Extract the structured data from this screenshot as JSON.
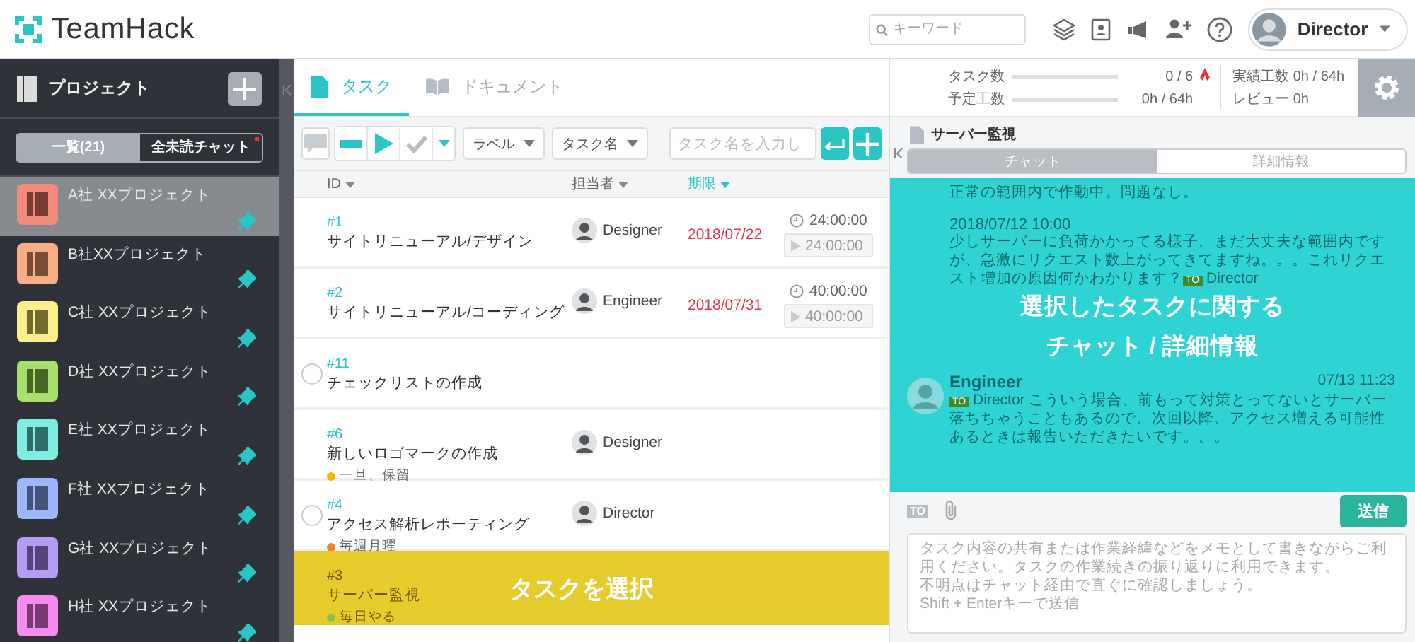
{
  "header": {
    "logo": "TeamHack",
    "search": {
      "placeholder": "キーワード"
    },
    "user": {
      "name": "Director"
    }
  },
  "sidebar": {
    "title": "プロジェクト",
    "tabs": [
      {
        "label": "一覧(21)",
        "selected": true,
        "unread": false
      },
      {
        "label": "全未読チャット",
        "selected": false,
        "unread": true
      }
    ],
    "projects": [
      {
        "name": "A社 XXプロジェクト",
        "color": "#f28b7a",
        "selected": true
      },
      {
        "name": "B社XXプロジェクト",
        "color": "#f7ae86",
        "selected": false
      },
      {
        "name": "C社 XXプロジェクト",
        "color": "#fbee8c",
        "selected": false
      },
      {
        "name": "D社 XXプロジェクト",
        "color": "#a8e06c",
        "selected": false
      },
      {
        "name": "E社 XXプロジェクト",
        "color": "#80ece2",
        "selected": false
      },
      {
        "name": "F社 XXプロジェクト",
        "color": "#9cb8fa",
        "selected": false
      },
      {
        "name": "G社 XXプロジェクト",
        "color": "#b69bf5",
        "selected": false
      },
      {
        "name": "H社 XXプロジェクト",
        "color": "#f68cf0",
        "selected": false
      }
    ]
  },
  "main": {
    "tabs": [
      {
        "label": "タスク",
        "kind": "task",
        "selected": true
      },
      {
        "label": "ドキュメント",
        "kind": "document",
        "selected": false
      }
    ],
    "stats": [
      {
        "label": "タスク数",
        "level": 0,
        "reading": "0 / 6",
        "alert": true
      },
      {
        "label": "予定工数",
        "level": 0,
        "reading": "0h / 64h",
        "alert": false
      }
    ],
    "totals": [
      "実績工数 0h / 64h",
      "レビュー 0h"
    ],
    "toolbar": {
      "label_filter": "ラベル",
      "name_filter": "タスク名",
      "search": {
        "placeholder": "タスク名を入力し"
      }
    },
    "columns": [
      {
        "label": "ID",
        "sorted": false
      },
      {
        "label": "担当者",
        "sorted": false
      },
      {
        "label": "期限",
        "sorted": true
      }
    ],
    "tasks": [
      {
        "id": "#1",
        "title": "サイトリニューアル/デザイン",
        "kind": "task",
        "assignee": "Designer",
        "due": "2018/07/22",
        "estimate": "24:00:00",
        "timer": "24:00:00",
        "selected": false
      },
      {
        "id": "#2",
        "title": "サイトリニューアル/コーディング",
        "kind": "task",
        "assignee": "Engineer",
        "due": "2018/07/31",
        "estimate": "40:00:00",
        "timer": "40:00:00",
        "selected": false
      },
      {
        "id": "#11",
        "title": "チェックリストの作成",
        "kind": "checklist",
        "selected": false
      },
      {
        "id": "#6",
        "title": "新しいロゴマークの作成",
        "kind": "task",
        "assignee": "Designer",
        "label": {
          "text": "一旦、保留",
          "color": "#f5b800"
        },
        "selected": false
      },
      {
        "id": "#4",
        "title": "アクセス解析レポーティング",
        "kind": "checklist",
        "assignee": "Director",
        "label": {
          "text": "毎週月曜",
          "color": "#f0832a"
        },
        "selected": false
      },
      {
        "id": "#3",
        "title": "サーバー監視",
        "kind": "task",
        "label": {
          "text": "毎日やる",
          "color": "#8bc34a"
        },
        "selected": true
      }
    ],
    "callout": "タスクを選択"
  },
  "detail": {
    "title": "サーバー監視",
    "tabs": [
      {
        "label": "チャット",
        "selected": true
      },
      {
        "label": "詳細情報",
        "selected": false
      }
    ],
    "messages": [
      {
        "kind": "continued",
        "text": "正常の範囲内で作動中。問題なし。"
      },
      {
        "kind": "continued",
        "time": "2018/07/12 10:00",
        "text": "少しサーバーに負荷かかってる様子。まだ大丈夫な範囲内ですが、急激にリクエスト数上がってきてますね。。。これリクエスト増加の原因何かわかります？",
        "badge": "TO",
        "to": "Director"
      },
      {
        "kind": "new",
        "author": "Engineer",
        "time": "07/13 11:23",
        "badge": "TO",
        "to": "Director",
        "text": "こういう場合、前もって対策とってないとサーバー落ちちゃうこともあるので、次回以降、アクセス増える可能性あるときは報告いただきたいです。。。"
      }
    ],
    "callout": [
      "選択したタスクに関する",
      "チャット / 詳細情報"
    ],
    "composer": {
      "to": "TO",
      "send": "送信",
      "placeholder": [
        "タスク内容の共有または作業経緯などをメモとして書きながらご利用ください。タスクの作業続きの振り返りに利用できます。",
        "不明点はチャット経由で直ぐに確認しましょう。",
        "Shift + Enterキーで送信"
      ]
    }
  }
}
